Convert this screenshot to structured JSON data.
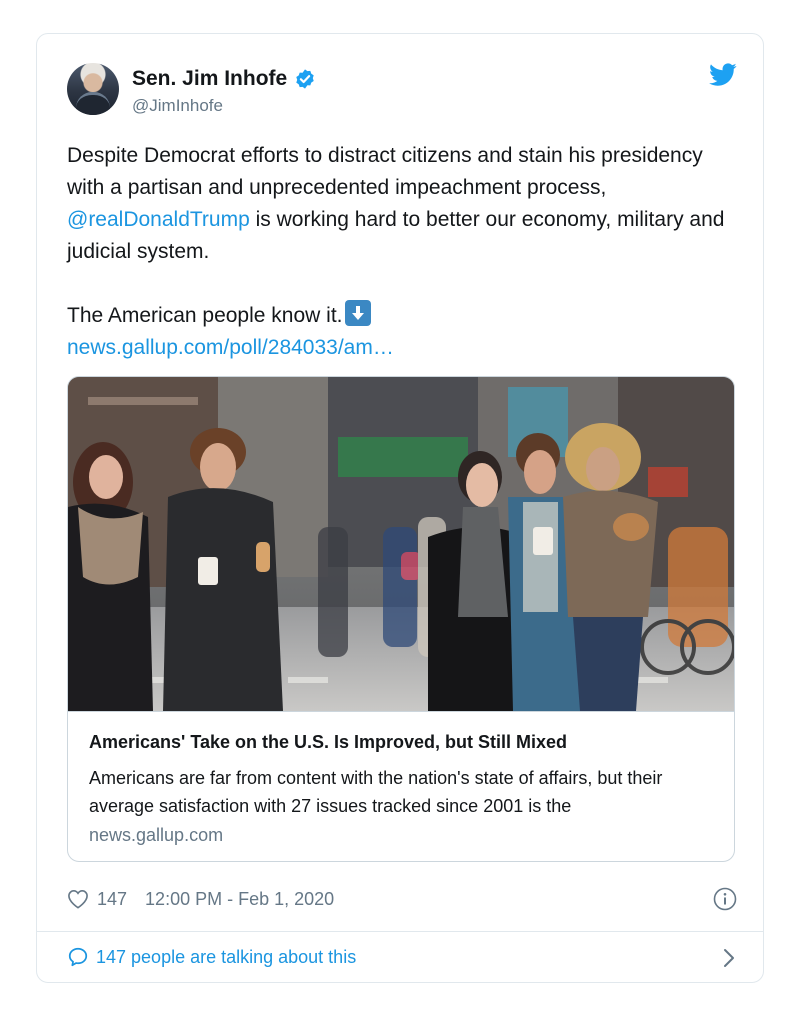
{
  "tweet": {
    "author": {
      "display_name": "Sen. Jim Inhofe",
      "handle": "@JimInhofe",
      "verified": true
    },
    "text": {
      "line1": "Despite Democrat efforts to distract citizens and stain his presidency with a partisan and unprecedented impeachment process, ",
      "mention": "@realDonaldTrump",
      "line1_end": " is working hard to better our economy, military and judicial system.",
      "line2": "The American people know it.",
      "emoji": "down-arrow-emoji",
      "link": "news.gallup.com/poll/284033/am…"
    },
    "card": {
      "title": "Americans' Take on the U.S. Is Improved, but Still Mixed",
      "description": "Americans are far from content with the nation's state of affairs, but their average satisfaction with 27 issues tracked since 2001 is the",
      "domain": "news.gallup.com"
    },
    "likes": "147",
    "timestamp": "12:00 PM - Feb 1, 2020",
    "talking": "147 people are talking about this"
  },
  "colors": {
    "accent": "#1b95e0",
    "verified": "#1da1f2",
    "muted": "#657786",
    "border": "#e1e8ed"
  },
  "icons": [
    "verified-icon",
    "twitter-icon",
    "down-arrow-emoji",
    "heart-icon",
    "info-icon",
    "speech-bubble-icon",
    "chevron-right-icon"
  ]
}
